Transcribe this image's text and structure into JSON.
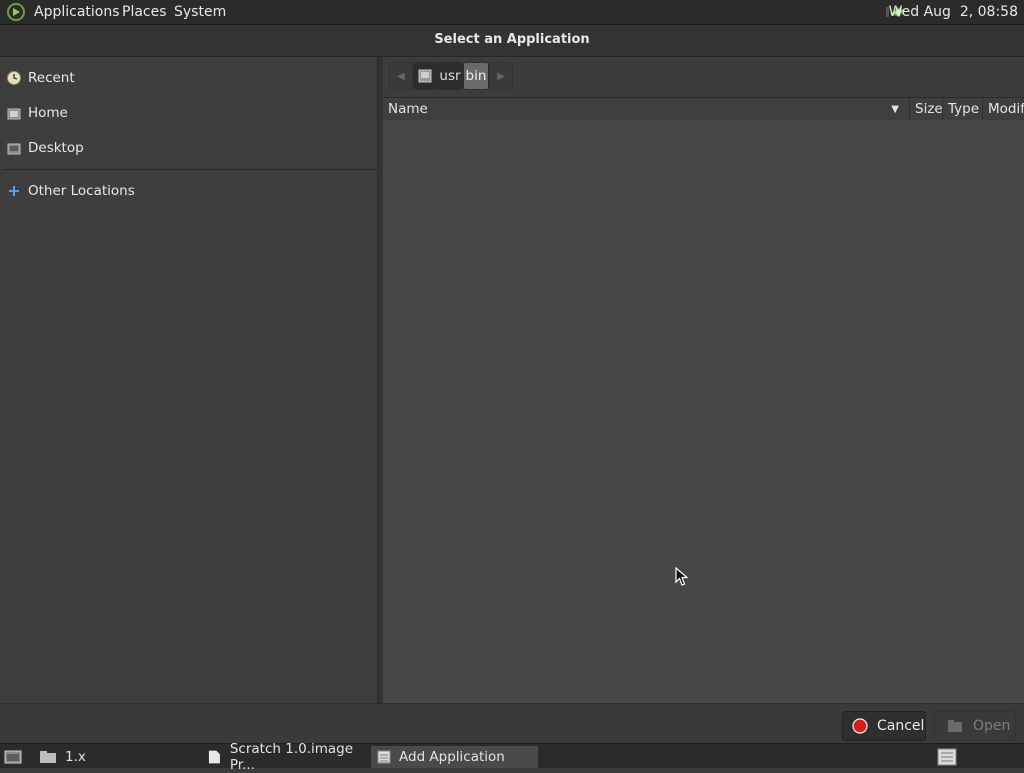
{
  "top_panel": {
    "menus": [
      "Applications",
      "Places",
      "System"
    ],
    "clock": "Wed Aug  2, 08:58"
  },
  "dialog": {
    "title": "Select an Application",
    "sidebar": {
      "places": [
        {
          "label": "Recent",
          "icon": "clock-icon"
        },
        {
          "label": "Home",
          "icon": "home-icon"
        },
        {
          "label": "Desktop",
          "icon": "desktop-icon"
        }
      ],
      "other": {
        "label": "Other Locations",
        "icon": "plus-icon"
      }
    },
    "path_bar": {
      "segments": [
        "usr",
        "bin"
      ],
      "active": "bin"
    },
    "columns": {
      "name": "Name",
      "size": "Size",
      "type": "Type",
      "modified": "Modif"
    },
    "buttons": {
      "cancel": "Cancel",
      "open": "Open"
    }
  },
  "taskbar": {
    "tasks": [
      {
        "label": "1.x",
        "icon": "folder-icon"
      },
      {
        "label": "Scratch 1.0.image Pr...",
        "icon": "document-icon"
      },
      {
        "label": "Add Application",
        "icon": "window-icon"
      }
    ]
  },
  "colors": {
    "panel": "#2b2b2b",
    "dialog_bg": "#3c3c3c",
    "list_bg": "#474747",
    "cancel_red": "#d21e1e"
  }
}
